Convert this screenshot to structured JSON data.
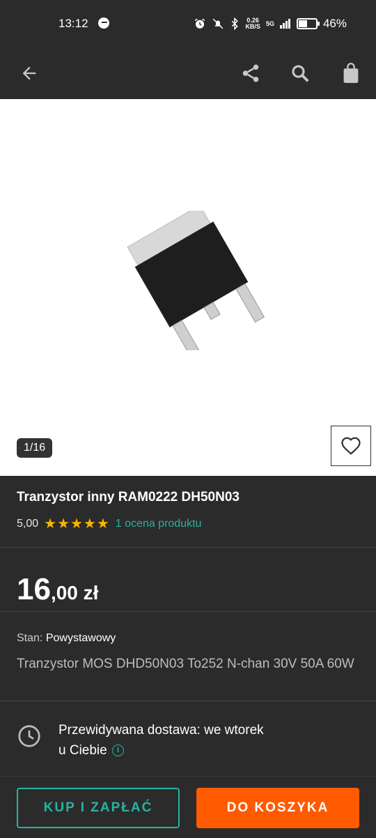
{
  "status_bar": {
    "time": "13:12",
    "net_speed_value": "0.26",
    "net_speed_unit": "KB/S",
    "network": "5G",
    "battery_text": "46%",
    "battery_level": 0.46
  },
  "gallery": {
    "counter": "1/16"
  },
  "product": {
    "title": "Tranzystor inny RAM0222 DH50N03",
    "rating_value": "5,00",
    "stars": "★★★★★",
    "rating_count_label": "1 ocena produktu",
    "price_main": "16",
    "price_decimal": ",00 zł",
    "condition_label": "Stan:",
    "condition_value": "Powystawowy",
    "description": "Tranzystor MOS DHD50N03 To252 N-chan 30V 50A 60W"
  },
  "delivery": {
    "line1": "Przewidywana dostawa: we wtorek",
    "line2": "u Ciebie",
    "info_icon": "i"
  },
  "actions": {
    "buy_label": "KUP I ZAPŁAĆ",
    "cart_label": "DO KOSZYKA"
  },
  "colors": {
    "accent": "#26b3a3",
    "cart": "#ff5a00",
    "star": "#f7b500",
    "background": "#2b2b2b"
  }
}
